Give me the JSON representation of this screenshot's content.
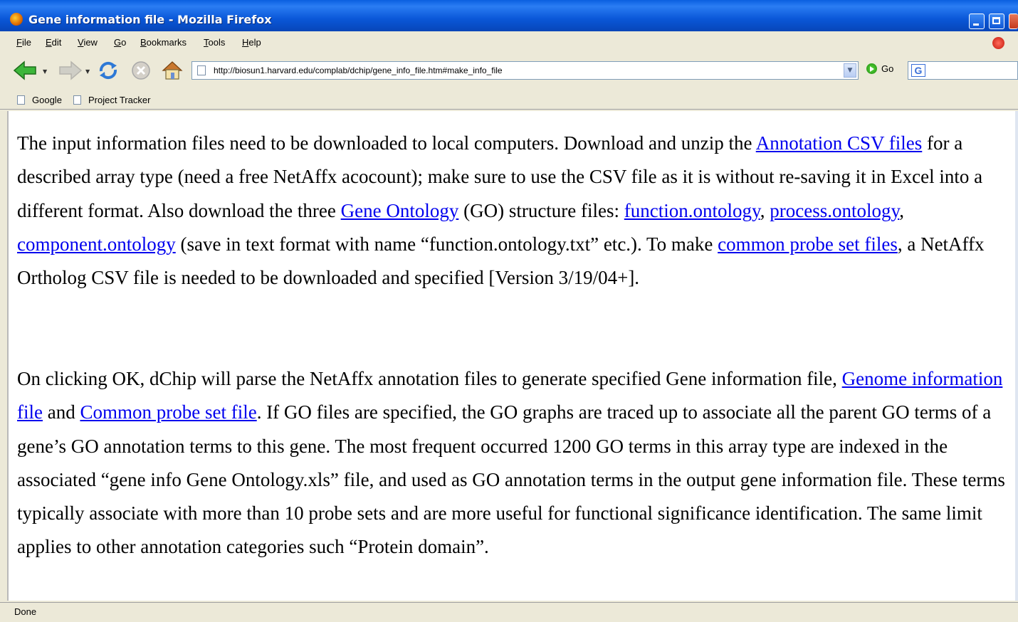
{
  "window": {
    "title": "Gene information file - Mozilla Firefox"
  },
  "menu": {
    "items": [
      "File",
      "Edit",
      "View",
      "Go",
      "Bookmarks",
      "Tools",
      "Help"
    ]
  },
  "navigation": {
    "url": "http://biosun1.harvard.edu/complab/dchip/gene_info_file.htm#make_info_file",
    "go_label": "Go",
    "search_icon_text": "G"
  },
  "bookmarks": {
    "items": [
      "Google",
      "Project Tracker"
    ]
  },
  "content": {
    "p1": {
      "t1": "The input information files need to be downloaded to local computers. Download and unzip the ",
      "link_annotation": "Annotation CSV files",
      "t2": " for a described array type (need a free NetAffx acocount); make sure to use the CSV file as it is without re-saving it in Excel into a different format. Also download the three ",
      "link_gene_ontology": "Gene Ontology",
      "t3": " (GO) structure files: ",
      "link_function": "function.ontology",
      "t4": ", ",
      "link_process": "process.ontology",
      "t5": ", ",
      "link_component": "component.ontology",
      "t6": " (save in text format with name “function.ontology.txt” etc.). To make ",
      "link_common_probe": "common probe set files",
      "t7": ", a NetAffx Ortholog CSV file is needed to be downloaded and specified [Version 3/19/04+]."
    },
    "p2": {
      "t1": "On clicking OK, dChip will parse the NetAffx annotation files to generate specified Gene information file, ",
      "link_genome": "Genome information file",
      "t2": " and ",
      "link_common": "Common probe set file",
      "t3": ". If GO files are specified, the GO graphs are traced up to associate all the parent GO terms of a gene’s GO annotation terms to this gene. The most frequent occurred 1200 GO terms in this array type are indexed in the associated “gene info Gene Ontology.xls” file, and used as GO annotation terms in the output gene information file. These terms typically associate with more than 10 probe sets and are more useful for functional significance identification. The same limit applies to other annotation categories such “Protein domain”."
    }
  },
  "status": {
    "text": "Done"
  },
  "icons": [
    "firefox-icon",
    "back-arrow-icon",
    "forward-arrow-icon",
    "reload-icon",
    "stop-icon",
    "home-icon",
    "page-icon",
    "go-icon",
    "google-search-icon",
    "stop-throbber-icon"
  ]
}
